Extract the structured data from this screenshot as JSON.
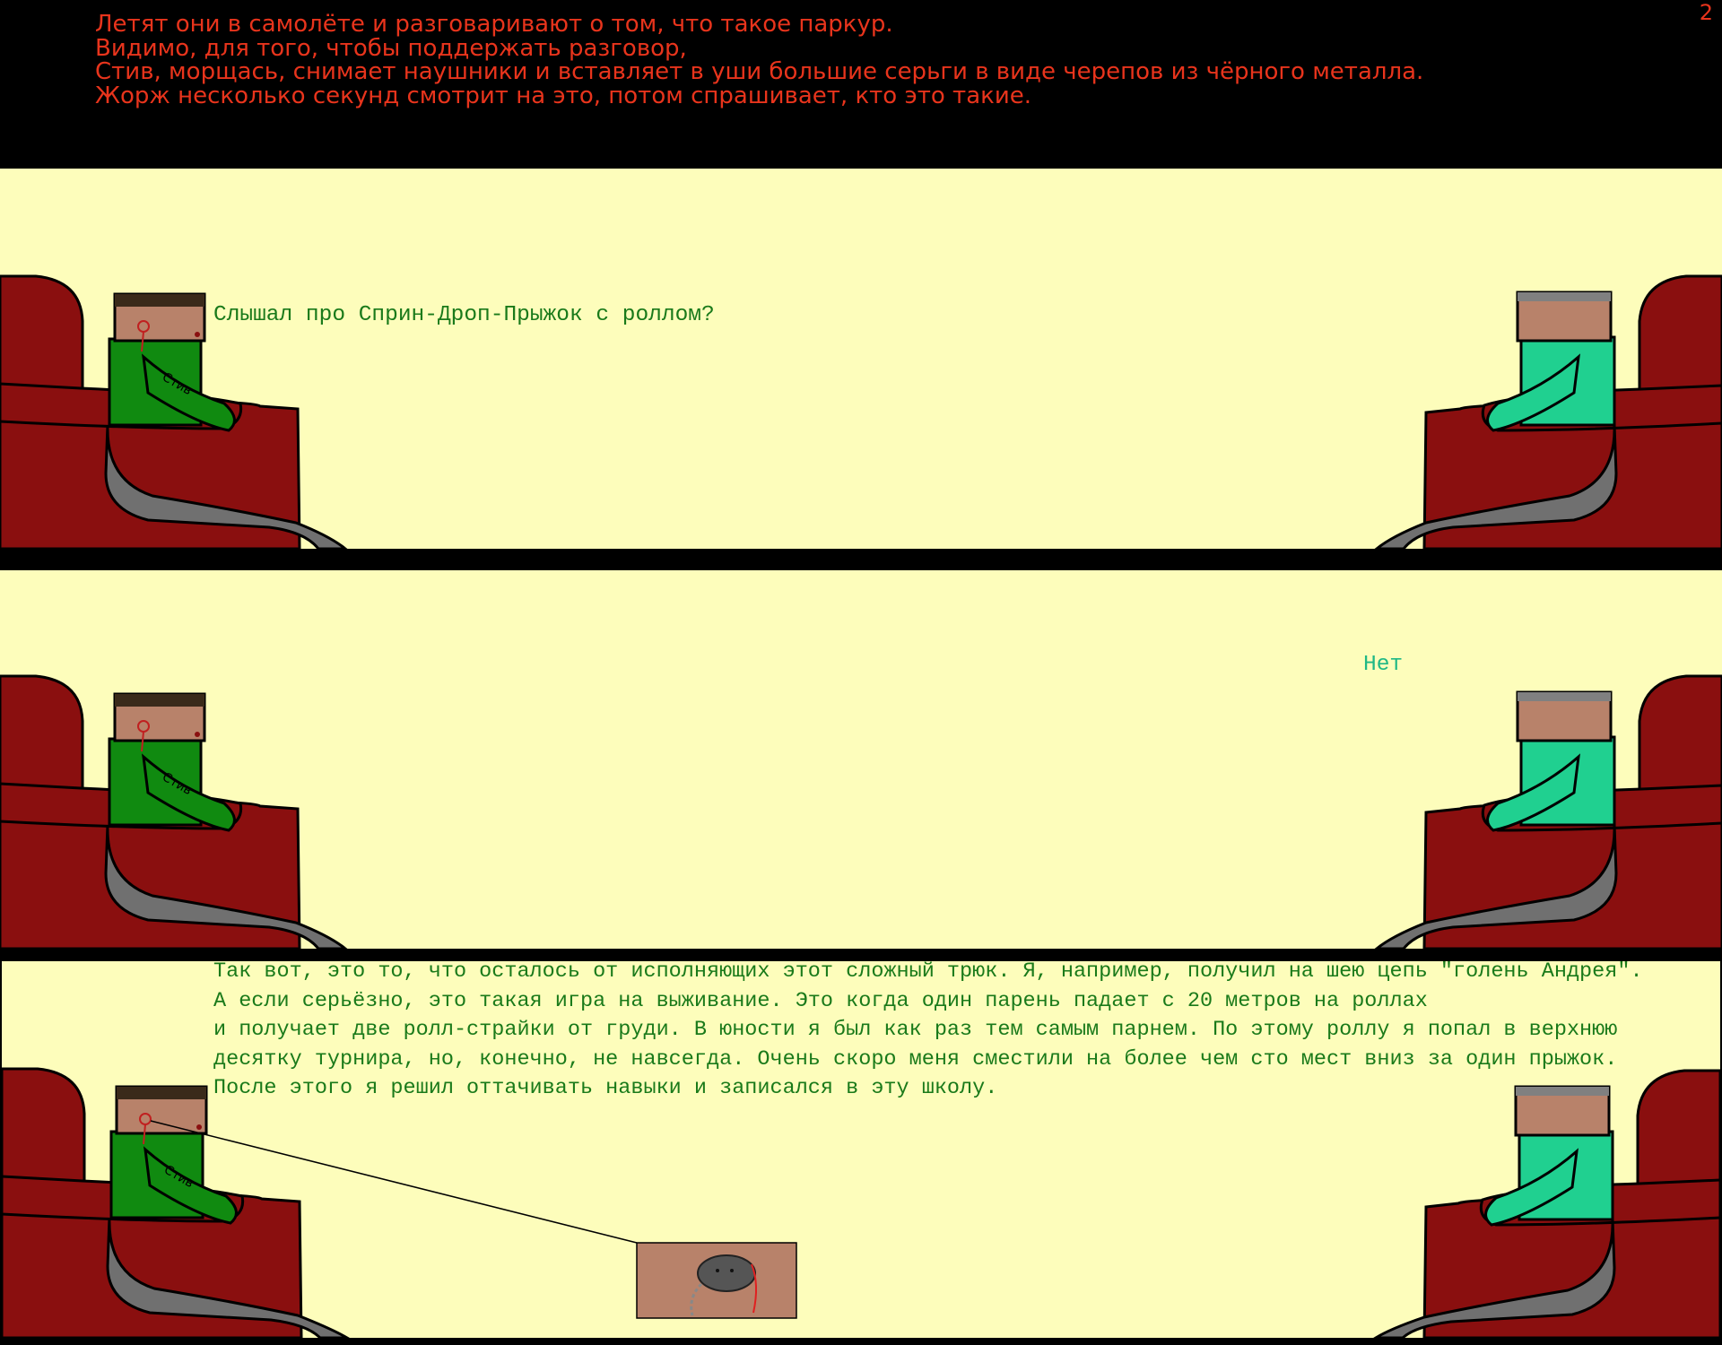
{
  "page_number": "2",
  "narration": [
    "Летят они в самолёте и разговаривают о том, что такое паркур.",
    "Видимо, для того, чтобы поддержать разговор,",
    "Стив, морщась, снимает наушники и вставляет в уши большие серьги в виде черепов из чёрного металла.",
    "Жорж несколько секунд смотрит на это, потом спрашивает, кто это такие."
  ],
  "panels": [
    {
      "lines": [
        "Слышал про Сприн-Дроп-Прыжок с роллом?"
      ]
    },
    {
      "lines": [
        "Нет"
      ]
    },
    {
      "lines": [
        "Так вот, это то, что осталось от исполняющих этот сложный трюк. Я, например, получил на шею цепь \"голень Андрея\".",
        "А если серьёзно, это такая игра на выживание. Это когда один парень падает с 20 метров на роллах",
        "и получает две ролл-страйки от груди. В юности я был как раз тем самым парнем. По этому роллу я попал в верхнюю",
        "десятку турнира, но, конечно, не навсегда. Очень скоро меня сместили на более чем сто мест вниз за один прыжок.",
        "После этого я решил оттачивать навыки и записался в эту школу."
      ]
    }
  ],
  "sleeve_text": "Стив",
  "colors": {
    "narration": "#e8341c",
    "panel_bg": "#fdfdbb",
    "seat": "#8a0f0f",
    "steve_shirt": "#108a10",
    "george_shirt": "#20d090",
    "pants": "#707070",
    "skin": "#b8826a"
  }
}
